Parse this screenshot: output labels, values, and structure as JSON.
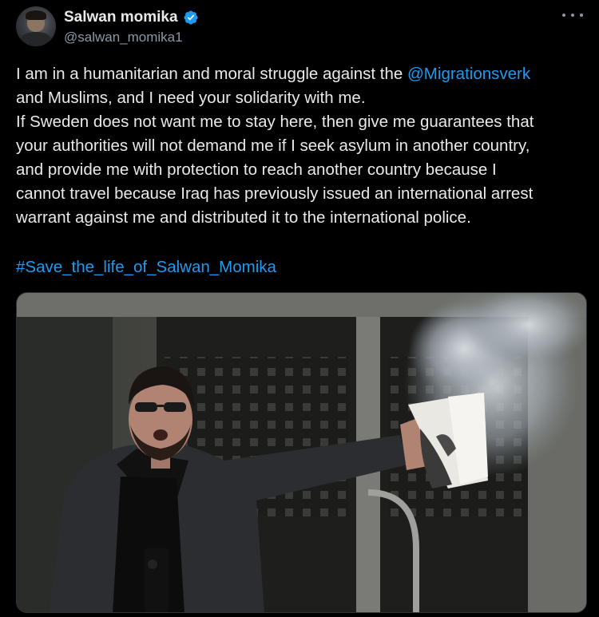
{
  "author": {
    "display_name": "Salwan momika",
    "handle": "@salwan_momika1",
    "verified": true,
    "avatar_icon": "user-avatar",
    "verified_icon": "verified-badge-icon",
    "verified_color": "#1d9bf0"
  },
  "menu": {
    "icon": "more-options-icon"
  },
  "text": {
    "line1_prefix": "I am in a humanitarian and moral struggle against the ",
    "mention": "@Migrationsverk",
    "line2": "and Muslims, and I need your solidarity with me.",
    "line3": "If Sweden does not want me to stay here, then give me guarantees that",
    "line4": "your authorities will not demand me if I seek asylum in another country,",
    "line5": "and provide me with protection to reach another country because I",
    "line6": "cannot travel because Iraq has previously issued an international arrest",
    "line7": "warrant against me and distributed it to the international police."
  },
  "hashtag": "#Save_the_life_of_Salwan_Momika",
  "colors": {
    "background": "#000000",
    "text": "#e7e9ea",
    "secondary": "#8b98a5",
    "link": "#1d9bf0"
  }
}
